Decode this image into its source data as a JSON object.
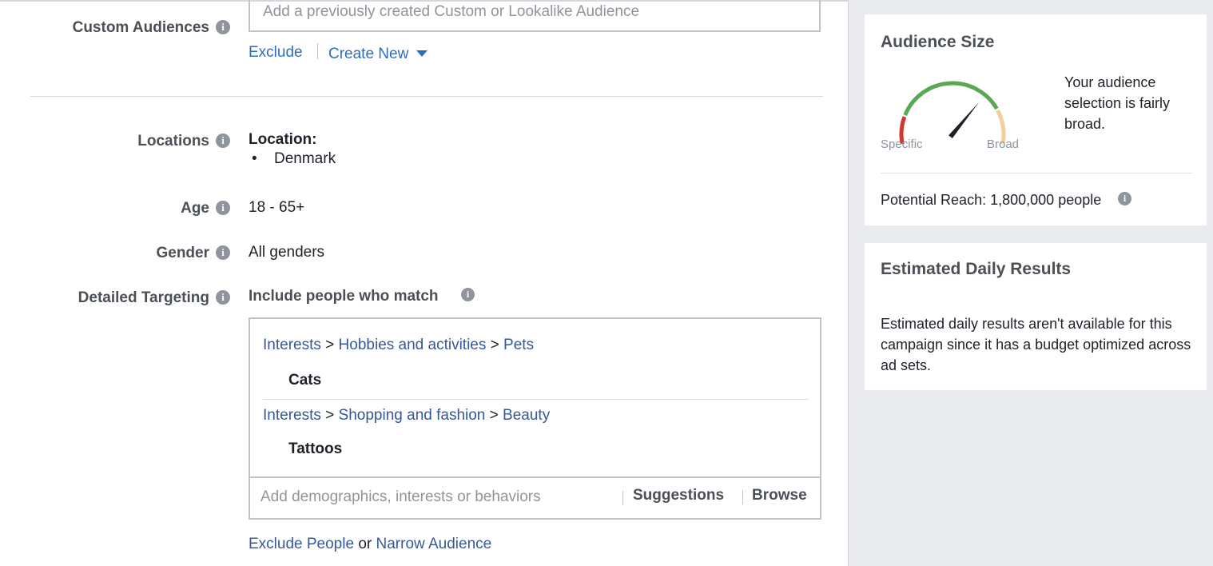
{
  "custom_audiences": {
    "label": "Custom Audiences",
    "placeholder": "Add a previously created Custom or Lookalike Audience",
    "exclude_label": "Exclude",
    "create_new_label": "Create New"
  },
  "locations": {
    "label": "Locations",
    "heading": "Location:",
    "items": [
      "Denmark"
    ]
  },
  "age": {
    "label": "Age",
    "value": "18 - 65+"
  },
  "gender": {
    "label": "Gender",
    "value": "All genders"
  },
  "detailed_targeting": {
    "label": "Detailed Targeting",
    "include_label": "Include people who match",
    "groups": [
      {
        "path": [
          "Interests",
          "Hobbies and activities",
          "Pets"
        ],
        "item": "Cats"
      },
      {
        "path": [
          "Interests",
          "Shopping and fashion",
          "Beauty"
        ],
        "item": "Tattoos"
      }
    ],
    "path_separator": ">",
    "input_placeholder": "Add demographics, interests or behaviors",
    "suggestions_label": "Suggestions",
    "browse_label": "Browse",
    "exclude_people_label": "Exclude People",
    "or_label": "or",
    "narrow_audience_label": "Narrow Audience"
  },
  "audience_size": {
    "title": "Audience Size",
    "description": "Your audience selection is fairly broad.",
    "specific_label": "Specific",
    "broad_label": "Broad",
    "gauge_level": 0.72,
    "reach_label": "Potential Reach:",
    "reach_value": "1,800,000 people"
  },
  "estimated_results": {
    "title": "Estimated Daily Results",
    "text": "Estimated daily results aren't available for this campaign since it has a budget optimized across ad sets."
  },
  "colors": {
    "link": "#365899",
    "action_link": "#2d6cc0",
    "gauge_red": "#d0392f",
    "gauge_green": "#5ba755",
    "gauge_tan": "#f0cf9a"
  }
}
